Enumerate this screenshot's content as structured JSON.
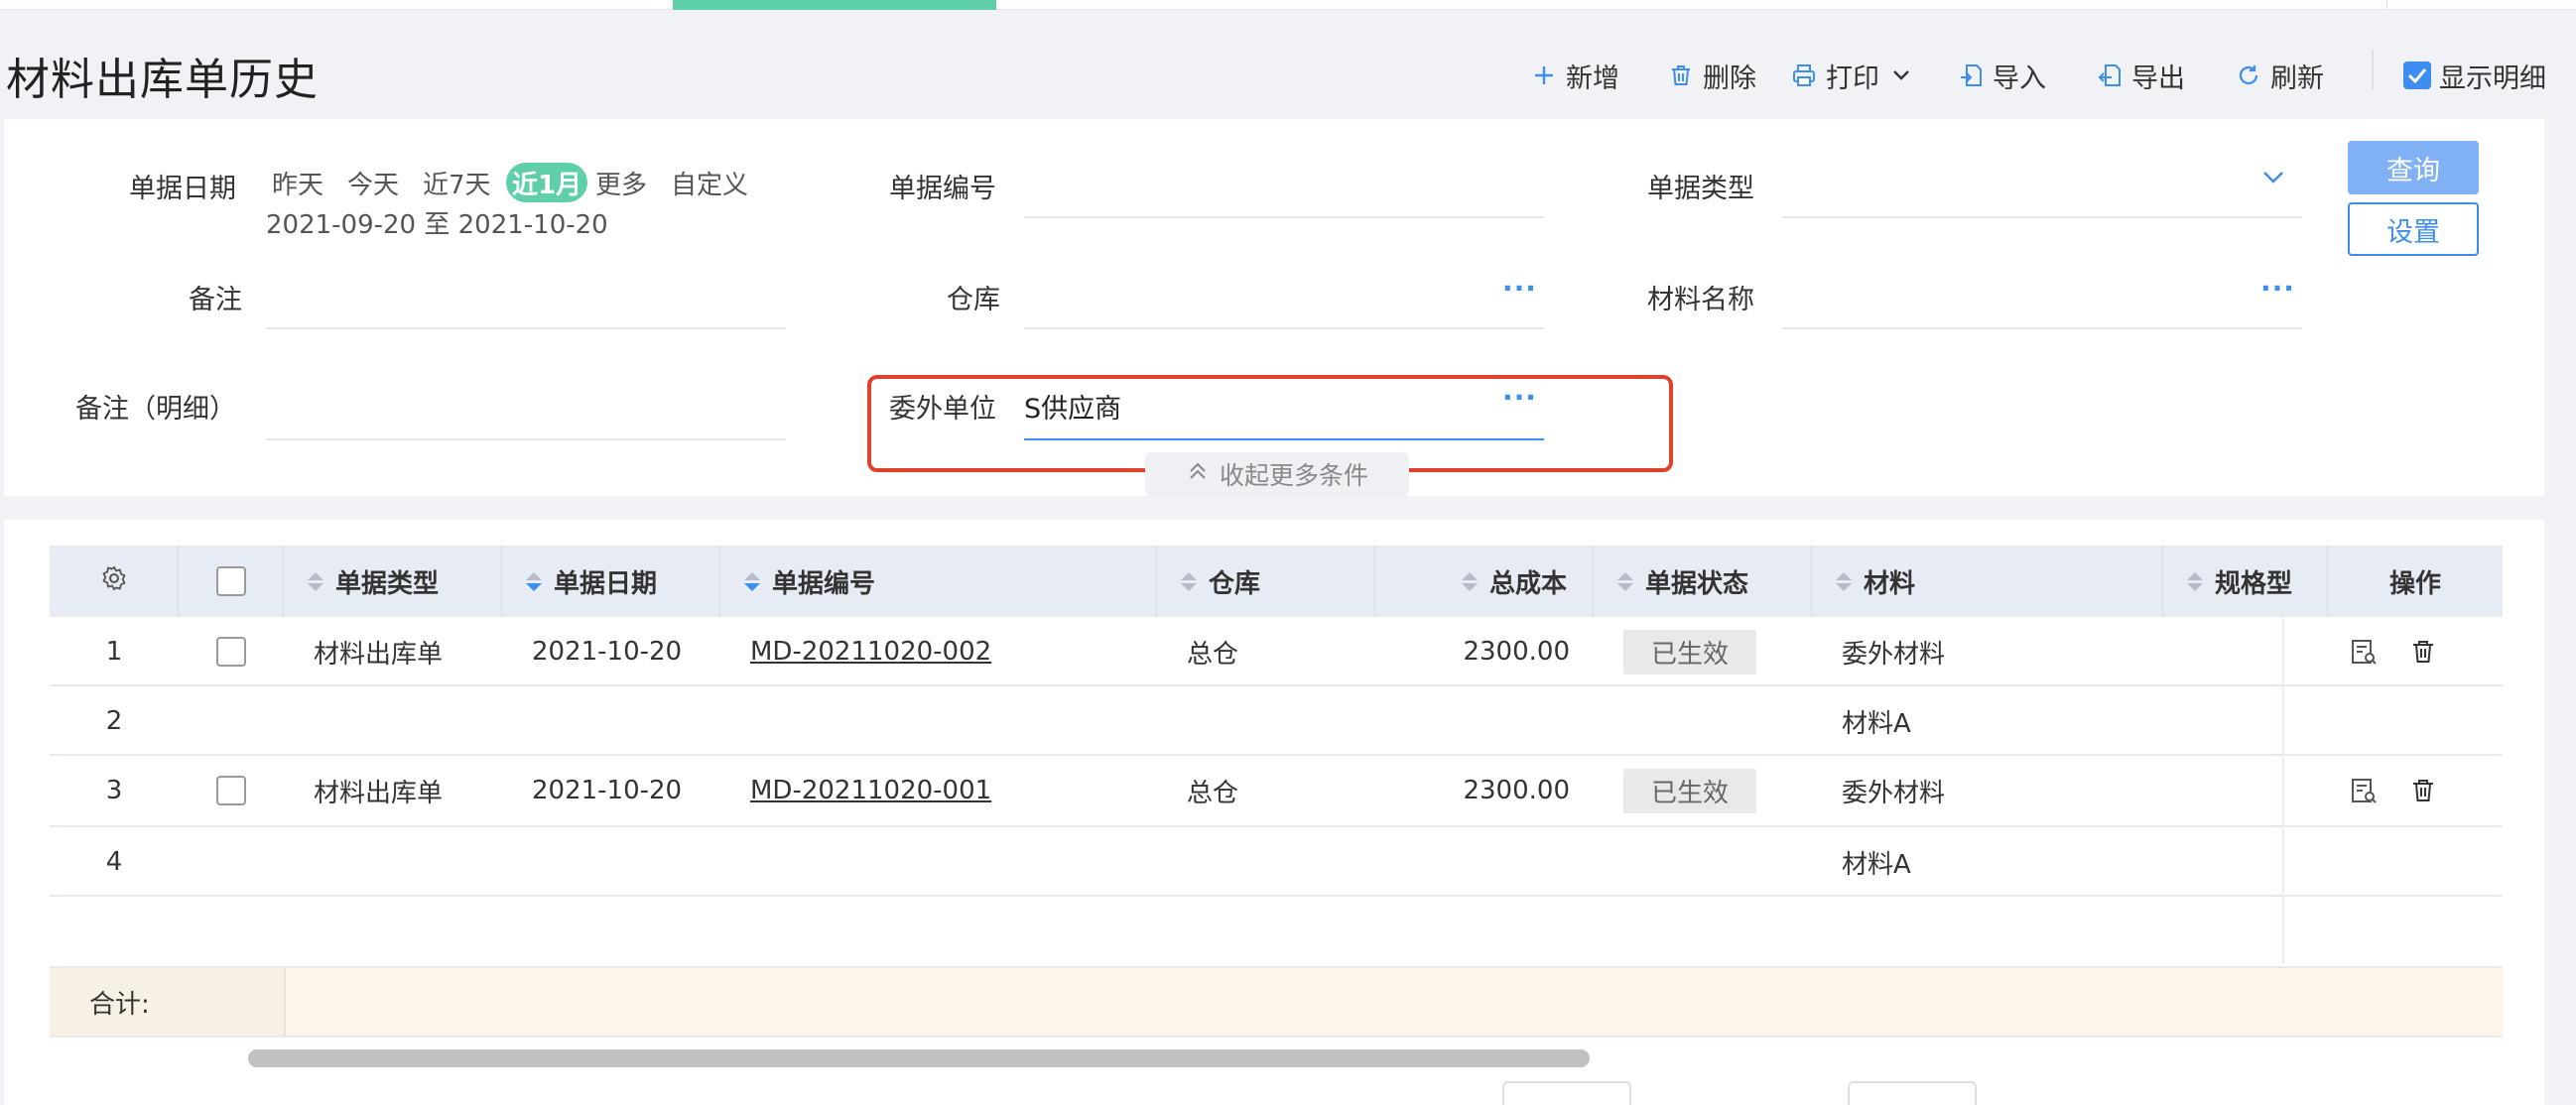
{
  "page": {
    "title": "材料出库单历史"
  },
  "toolbar": {
    "add": "新增",
    "delete": "删除",
    "print": "打印",
    "import": "导入",
    "export": "导出",
    "refresh": "刷新",
    "show_detail": "显示明细",
    "show_detail_checked": true
  },
  "filters": {
    "date_label": "单据日期",
    "date_options": [
      "昨天",
      "今天",
      "近7天",
      "近1月",
      "更多",
      "自定义"
    ],
    "date_selected": "近1月",
    "date_range": "2021-09-20 至 2021-10-20",
    "doc_no_label": "单据编号",
    "doc_no_value": "",
    "doc_type_label": "单据类型",
    "doc_type_value": "",
    "remark_label": "备注",
    "remark_value": "",
    "warehouse_label": "仓库",
    "warehouse_value": "",
    "material_name_label": "材料名称",
    "material_name_value": "",
    "remark_detail_label": "备注（明细）",
    "remark_detail_value": "",
    "outsource_label": "委外单位",
    "outsource_value": "S供应商",
    "query_button": "查询",
    "settings_button": "设置",
    "collapse_label": "收起更多条件"
  },
  "table": {
    "columns": [
      "单据类型",
      "单据日期",
      "单据编号",
      "仓库",
      "总成本",
      "单据状态",
      "材料",
      "规格型",
      "操作"
    ],
    "rows": [
      {
        "index": "1",
        "type": "材料出库单",
        "date": "2021-10-20",
        "no": "MD-20211020-002",
        "warehouse": "总仓",
        "cost": "2300.00",
        "status": "已生效",
        "material": "委外材料"
      },
      {
        "index": "2",
        "material": "材料A"
      },
      {
        "index": "3",
        "type": "材料出库单",
        "date": "2021-10-20",
        "no": "MD-20211020-001",
        "warehouse": "总仓",
        "cost": "2300.00",
        "status": "已生效",
        "material": "委外材料"
      },
      {
        "index": "4",
        "material": "材料A"
      }
    ],
    "summary_label": "合计:"
  },
  "colors": {
    "accent": "#3d8ef0",
    "selected_chip": "#5fcfa9",
    "highlight": "#e0412b",
    "summary_bg": "#fdf6e8"
  }
}
